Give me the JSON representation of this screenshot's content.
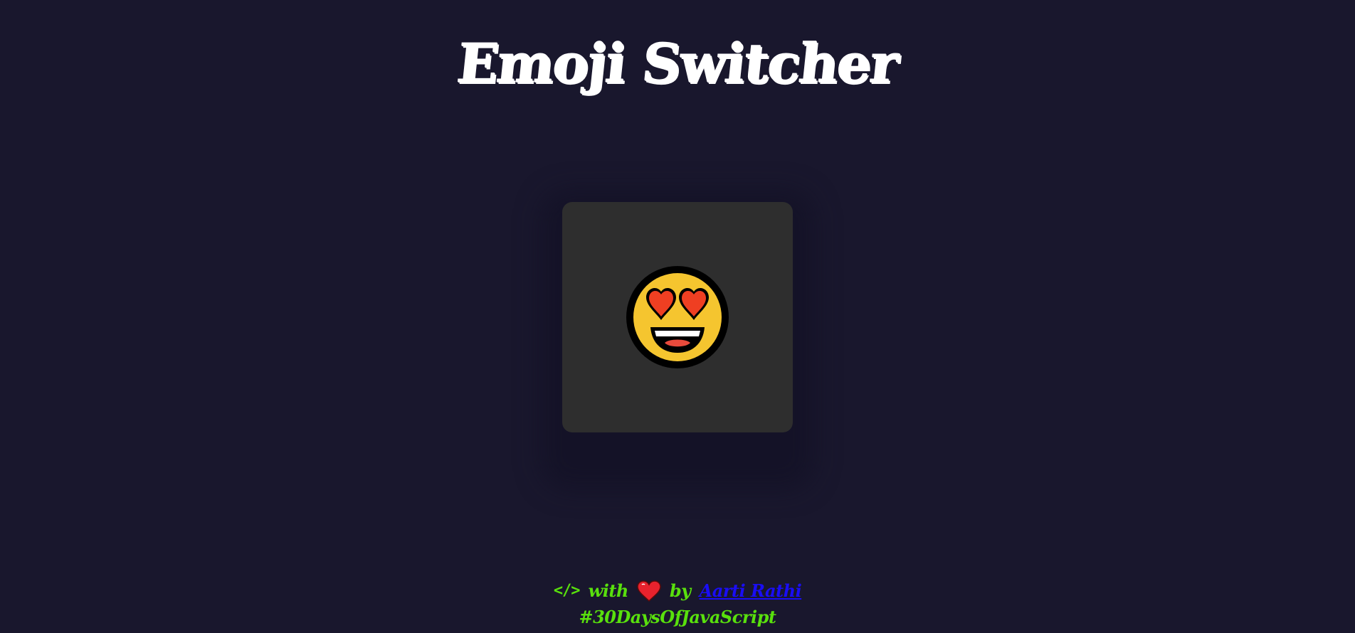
{
  "header": {
    "title": "Emoji Switcher"
  },
  "emoji_card": {
    "emoji_icon": "smiling-face-with-heart-eyes-icon"
  },
  "footer": {
    "code_symbol": "</>",
    "with_text": "with",
    "heart_icon": "red-heart-icon",
    "by_text": "by",
    "author_name": "Aarti Rathi",
    "hashtag": "#30DaysOfJavaScript"
  },
  "colors": {
    "background": "#19172d",
    "card": "#2e2e2e",
    "title": "#ffffff",
    "footer_text": "#59e00d",
    "link": "#1a0df5"
  }
}
